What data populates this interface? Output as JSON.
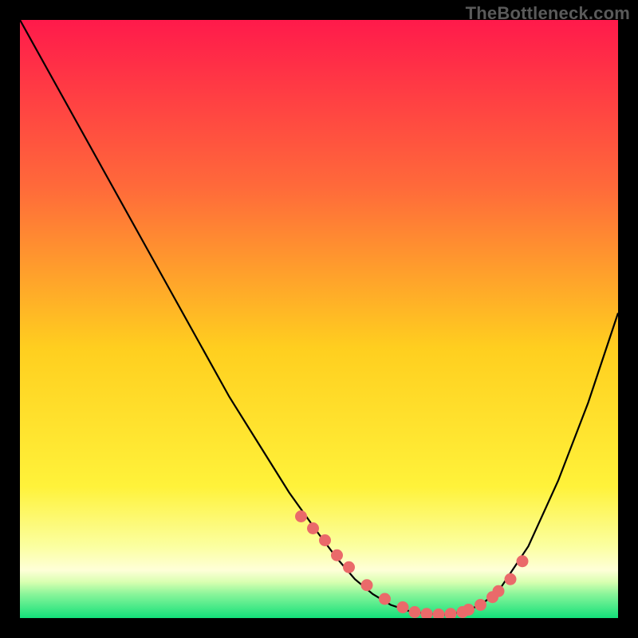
{
  "watermark": "TheBottleneck.com",
  "colors": {
    "frame": "#000000",
    "curve": "#000000",
    "dots": "#ea6a6a",
    "gradient_top": "#ff1a4b",
    "gradient_mid1": "#ff9a2a",
    "gradient_mid2": "#ffe400",
    "gradient_mid3": "#f7ff66",
    "gradient_bottom_yellow": "#fdffb0",
    "gradient_green": "#13e07a"
  },
  "chart_data": {
    "type": "line",
    "title": "",
    "xlabel": "",
    "ylabel": "",
    "xlim": [
      0,
      100
    ],
    "ylim": [
      0,
      100
    ],
    "series": [
      {
        "name": "bottleneck-curve",
        "x": [
          0,
          5,
          10,
          15,
          20,
          25,
          30,
          35,
          40,
          45,
          50,
          53,
          56,
          59,
          62,
          65,
          68,
          71,
          74,
          77,
          80,
          85,
          90,
          95,
          100
        ],
        "y": [
          100,
          91,
          82,
          73,
          64,
          55,
          46,
          37,
          29,
          21,
          14,
          10,
          6.5,
          4,
          2.2,
          1.2,
          0.7,
          0.6,
          1.0,
          2.2,
          4.5,
          12,
          23,
          36,
          51
        ]
      }
    ],
    "highlight_points": {
      "name": "highlight-dots",
      "x": [
        47,
        49,
        51,
        53,
        55,
        58,
        61,
        64,
        66,
        68,
        70,
        72,
        74,
        75,
        77,
        79,
        80,
        82,
        84
      ],
      "y": [
        17,
        15,
        13,
        10.5,
        8.5,
        5.5,
        3.2,
        1.8,
        1.0,
        0.7,
        0.6,
        0.7,
        1.0,
        1.4,
        2.2,
        3.5,
        4.5,
        6.5,
        9.5
      ]
    }
  }
}
